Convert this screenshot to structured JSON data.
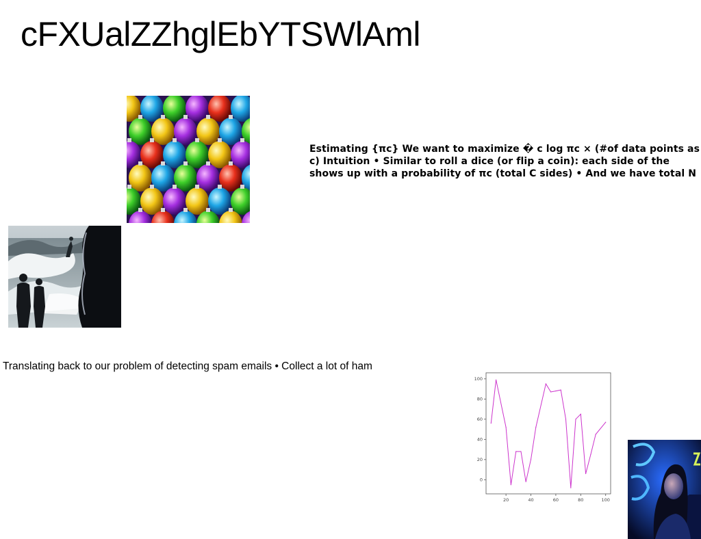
{
  "title": "cFXUalZZhglEbYTSWlAml",
  "bold_paragraph": "Estimating {πc} We want to maximize � c log πc × (#of data points as c) Intuition • Similar to roll a dice (or flip a coin): each side of the shows up with a probability of πc (total C sides) • And we have total N",
  "plain_paragraph": "Translating back to our problem of detecting spam emails • Collect a lot of ham",
  "images": {
    "ornaments": "colorful-ornaments-photo",
    "surfers": "beach-surfers-photo",
    "neon": "neon-portrait-photo"
  },
  "chart_data": {
    "type": "line",
    "x": [
      8,
      12,
      20,
      24,
      28,
      32,
      36,
      40,
      44,
      52,
      56,
      60,
      64,
      68,
      72,
      76,
      80,
      84,
      88,
      92,
      100
    ],
    "series": [
      {
        "values": [
          56,
          99,
          52,
          -5,
          28,
          28,
          -2,
          20,
          52,
          95,
          87,
          88,
          89,
          60,
          -8,
          60,
          65,
          6,
          25,
          45,
          57
        ]
      }
    ],
    "color": "#cc33cc",
    "xlim": [
      4,
      104
    ],
    "ylim": [
      -14,
      106
    ],
    "xticks": [
      20,
      40,
      60,
      80,
      100
    ],
    "yticks": [
      0,
      20,
      40,
      60,
      80,
      100
    ],
    "xlabel": "",
    "ylabel": "",
    "title": ""
  }
}
